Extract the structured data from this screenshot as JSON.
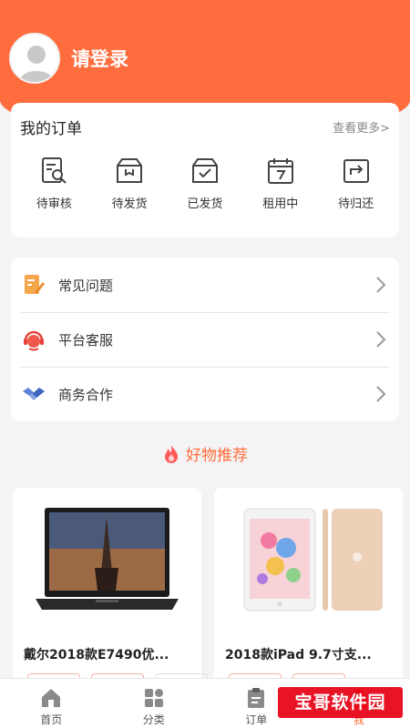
{
  "header": {
    "login_text": "请登录"
  },
  "orders": {
    "title": "我的订单",
    "more": "查看更多>",
    "items": [
      {
        "label": "待审核",
        "icon": "search-doc-icon"
      },
      {
        "label": "待发货",
        "icon": "box-icon"
      },
      {
        "label": "已发货",
        "icon": "box-check-icon"
      },
      {
        "label": "租用中",
        "icon": "calendar-icon"
      },
      {
        "label": "待归还",
        "icon": "return-icon"
      }
    ]
  },
  "menu": {
    "items": [
      {
        "label": "常见问题",
        "icon": "faq-icon"
      },
      {
        "label": "平台客服",
        "icon": "customer-service-icon"
      },
      {
        "label": "商务合作",
        "icon": "handshake-icon"
      }
    ]
  },
  "recommend": {
    "title": "好物推荐",
    "products": [
      {
        "name": "戴尔2018款E7490优..."
      },
      {
        "name": "2018款iPad 9.7寸支..."
      }
    ]
  },
  "tabbar": {
    "items": [
      {
        "label": "首页",
        "icon": "home-icon"
      },
      {
        "label": "分类",
        "icon": "category-icon"
      },
      {
        "label": "订单",
        "icon": "clipboard-icon"
      },
      {
        "label": "我",
        "icon": "user-icon"
      }
    ]
  },
  "watermark": {
    "text": "宝哥软件园"
  },
  "colors": {
    "accent": "#ff6d3e",
    "background": "#f4f4f4"
  }
}
